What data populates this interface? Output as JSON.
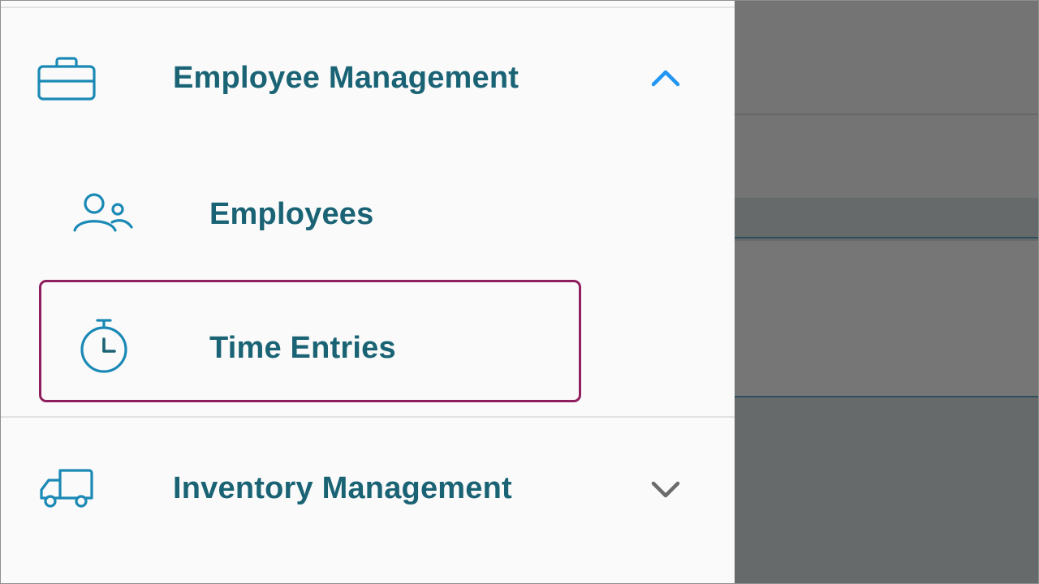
{
  "nav": {
    "employee_management": {
      "label": "Employee Management",
      "icon": "briefcase-icon",
      "expanded": true,
      "chevron": "chevron-up-icon",
      "chevron_color": "#2196f3",
      "items": [
        {
          "label": "Employees",
          "icon": "people-icon"
        },
        {
          "label": "Time Entries",
          "icon": "stopwatch-icon",
          "focused": true
        }
      ]
    },
    "inventory_management": {
      "label": "Inventory Management",
      "icon": "truck-icon",
      "expanded": false,
      "chevron": "chevron-down-icon",
      "chevron_color": "#6b6b6b"
    }
  },
  "colors": {
    "text": "#1a6375",
    "icon": "#1a89b5",
    "focus_outline": "#8e1e5e",
    "drawer_bg": "#fafafa",
    "overlay_bg": "#747474"
  }
}
